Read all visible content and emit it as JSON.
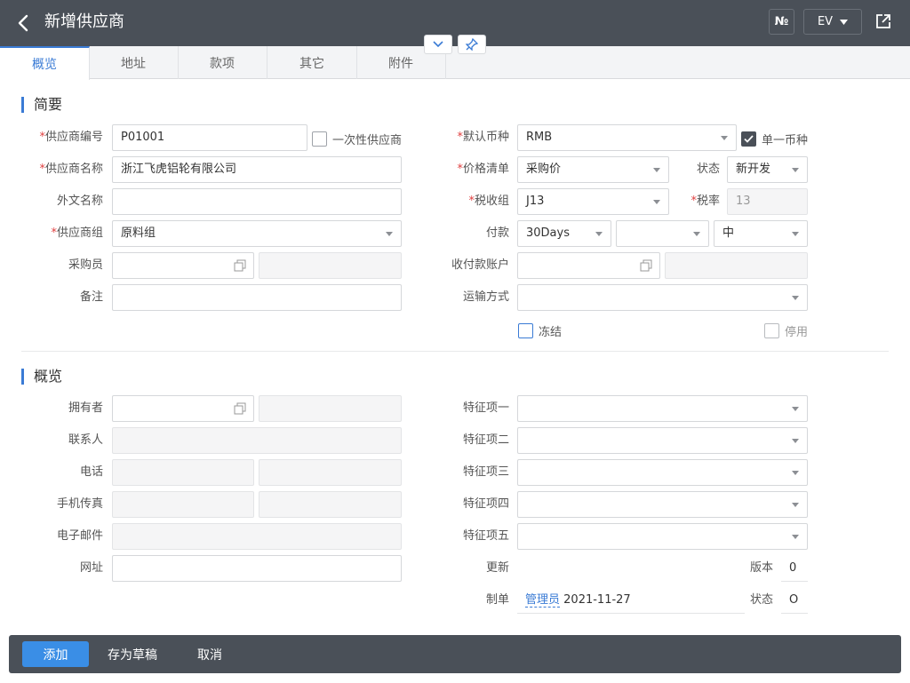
{
  "header": {
    "title": "新增供应商",
    "no_button": "№",
    "ev_button": "EV"
  },
  "tabs": [
    {
      "label": "概览"
    },
    {
      "label": "地址"
    },
    {
      "label": "款项"
    },
    {
      "label": "其它"
    },
    {
      "label": "附件"
    }
  ],
  "sections": {
    "summary": "简要",
    "overview": "概览"
  },
  "summary": {
    "supplier_code_label": "供应商编号",
    "supplier_code_value": "P01001",
    "one_time_label": "一次性供应商",
    "supplier_name_label": "供应商名称",
    "supplier_name_value": "浙江飞虎铝轮有限公司",
    "foreign_name_label": "外文名称",
    "supplier_group_label": "供应商组",
    "supplier_group_value": "原料组",
    "buyer_label": "采购员",
    "remark_label": "备注",
    "currency_label": "默认币种",
    "currency_value": "RMB",
    "single_currency_label": "单一币种",
    "price_list_label": "价格清单",
    "price_list_value": "采购价",
    "status_label": "状态",
    "status_value": "新开发",
    "tax_group_label": "税收组",
    "tax_group_value": "J13",
    "tax_rate_label": "税率",
    "tax_rate_value": "13",
    "payment_label": "付款",
    "payment_value": "30Days",
    "payment_extra_value": "中",
    "account_label": "收付款账户",
    "shipping_label": "运输方式",
    "frozen_label": "冻结",
    "disabled_label": "停用"
  },
  "overview": {
    "owner_label": "拥有者",
    "contact_label": "联系人",
    "phone_label": "电话",
    "mobile_fax_label": "手机传真",
    "email_label": "电子邮件",
    "website_label": "网址",
    "feature1_label": "特征项一",
    "feature2_label": "特征项二",
    "feature3_label": "特征项三",
    "feature4_label": "特征项四",
    "feature5_label": "特征项五",
    "updated_label": "更新",
    "version_label": "版本",
    "version_value": "0",
    "created_label": "制单",
    "created_by": "管理员",
    "created_date": "2021-11-27",
    "doc_status_label": "状态",
    "doc_status_value": "O"
  },
  "footer": {
    "add": "添加",
    "save_draft": "存为草稿",
    "cancel": "取消"
  },
  "colors": {
    "header_bg": "#4a5058",
    "accent": "#3a7bd5",
    "primary_button": "#3a8ee6",
    "required": "#e04040"
  }
}
